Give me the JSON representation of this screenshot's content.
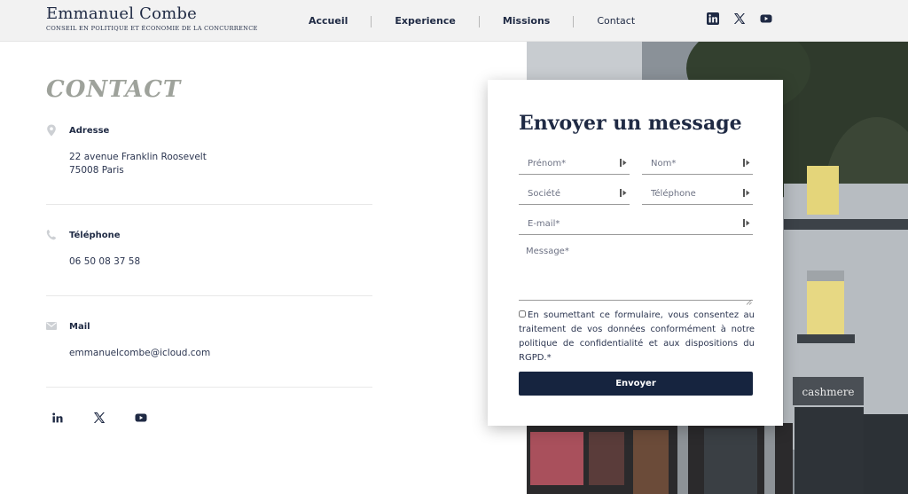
{
  "header": {
    "logo_name": "Emmanuel Combe",
    "logo_tagline": "CONSEIL EN POLITIQUE ET ÉCONOMIE DE LA CONCURRENCE",
    "nav": [
      {
        "label": "Accueil"
      },
      {
        "label": "Experience"
      },
      {
        "label": "Missions"
      },
      {
        "label": "Contact"
      }
    ],
    "social": [
      "linkedin-icon",
      "x-icon",
      "youtube-icon"
    ]
  },
  "contact": {
    "title": "CONTACT",
    "address": {
      "label": "Adresse",
      "value": "22 avenue Franklin Roosevelt\n75008 Paris",
      "icon": "location-pin-icon"
    },
    "phone": {
      "label": "Téléphone",
      "value": "06 50 08 37 58",
      "icon": "phone-icon"
    },
    "mail": {
      "label": "Mail",
      "value": "emmanuelcombe@icloud.com",
      "icon": "mail-icon"
    }
  },
  "form": {
    "title": "Envoyer un message",
    "firstname_placeholder": "Prénom*",
    "lastname_placeholder": "Nom*",
    "company_placeholder": "Société",
    "phone_placeholder": "Téléphone",
    "email_placeholder": "E-mail*",
    "message_placeholder": "Message*",
    "consent_text": "En soumettant ce formulaire, vous consentez au traitement de vos données conformément à notre politique de confidentialité et aux dispositions du RGPD.*",
    "submit_label": "Envoyer"
  },
  "colors": {
    "navy": "#1f2a44",
    "button": "#16243f",
    "title_gray": "#9ea29b",
    "header_bg": "#f2f2f2"
  }
}
